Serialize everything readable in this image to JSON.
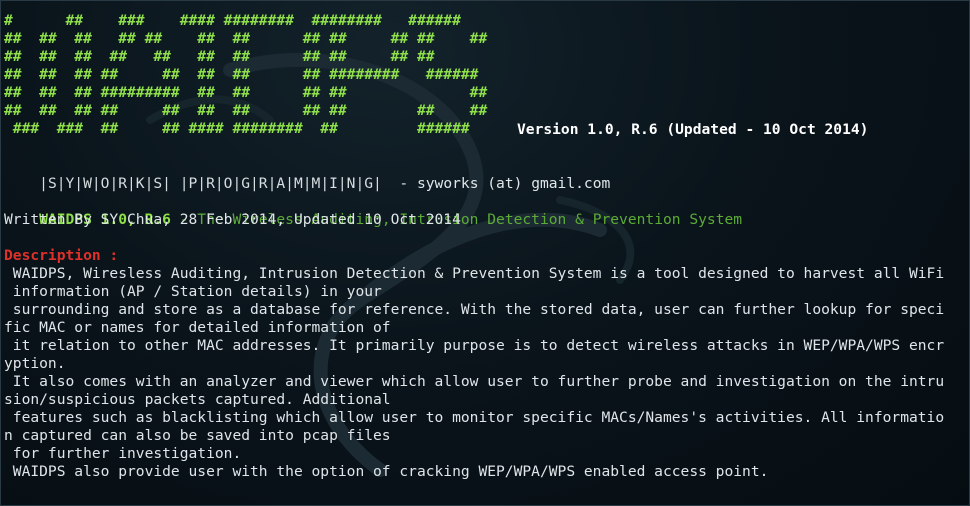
{
  "banner": [
    "#      ##    ###    #### ########  ########   ######",
    "##  ##  ##   ## ##    ##  ##      ## ##     ## ##    ##",
    "##  ##  ##  ##   ##   ##  ##      ## ##     ## ##",
    "##  ##  ## ##     ##  ##  ##      ## ########   ######",
    "##  ##  ## #########  ##  ##      ## ##              ##",
    "##  ##  ## ##     ##  ##  ##      ## ##        ##    ##",
    " ###  ###  ##     ## #### ########  ##         ######"
  ],
  "version": "Version 1.0, R.6 (Updated - 10 Oct 2014)",
  "syworks_line": {
    "programming_chars": "|S|Y|W|O|R|K|S| |P|R|O|G|R|A|M|M|I|N|G|",
    "contact": "  - syworks (at) gmail.com"
  },
  "app_title": {
    "name": "WAIDPS 1.0, R.6",
    "subtitle": " - The Wireless Auditing, Intrusion Detection & Prevention System"
  },
  "written_by": "Written By SY Chua, 28 Feb 2014, Updated 10 Oct 2014",
  "description_heading": "Description :",
  "description_lines": [
    " WAIDPS, Wiresless Auditing, Intrusion Detection & Prevention System is a tool designed to harvest all WiFi",
    " information (AP / Station details) in your",
    " surrounding and store as a database for reference. With the stored data, user can further lookup for speci",
    "fic MAC or names for detailed information of",
    " it relation to other MAC addresses. It primarily purpose is to detect wireless attacks in WEP/WPA/WPS encr",
    "yption.",
    " It also comes with an analyzer and viewer which allow user to further probe and investigation on the intru",
    "sion/suspicious packets captured. Additional",
    " features such as blacklisting which allow user to monitor specific MACs/Names's activities. All informatio",
    "n captured can also be saved into pcap files",
    " for further investigation.",
    " WAIDPS also provide user with the option of cracking WEP/WPA/WPS enabled access point."
  ]
}
